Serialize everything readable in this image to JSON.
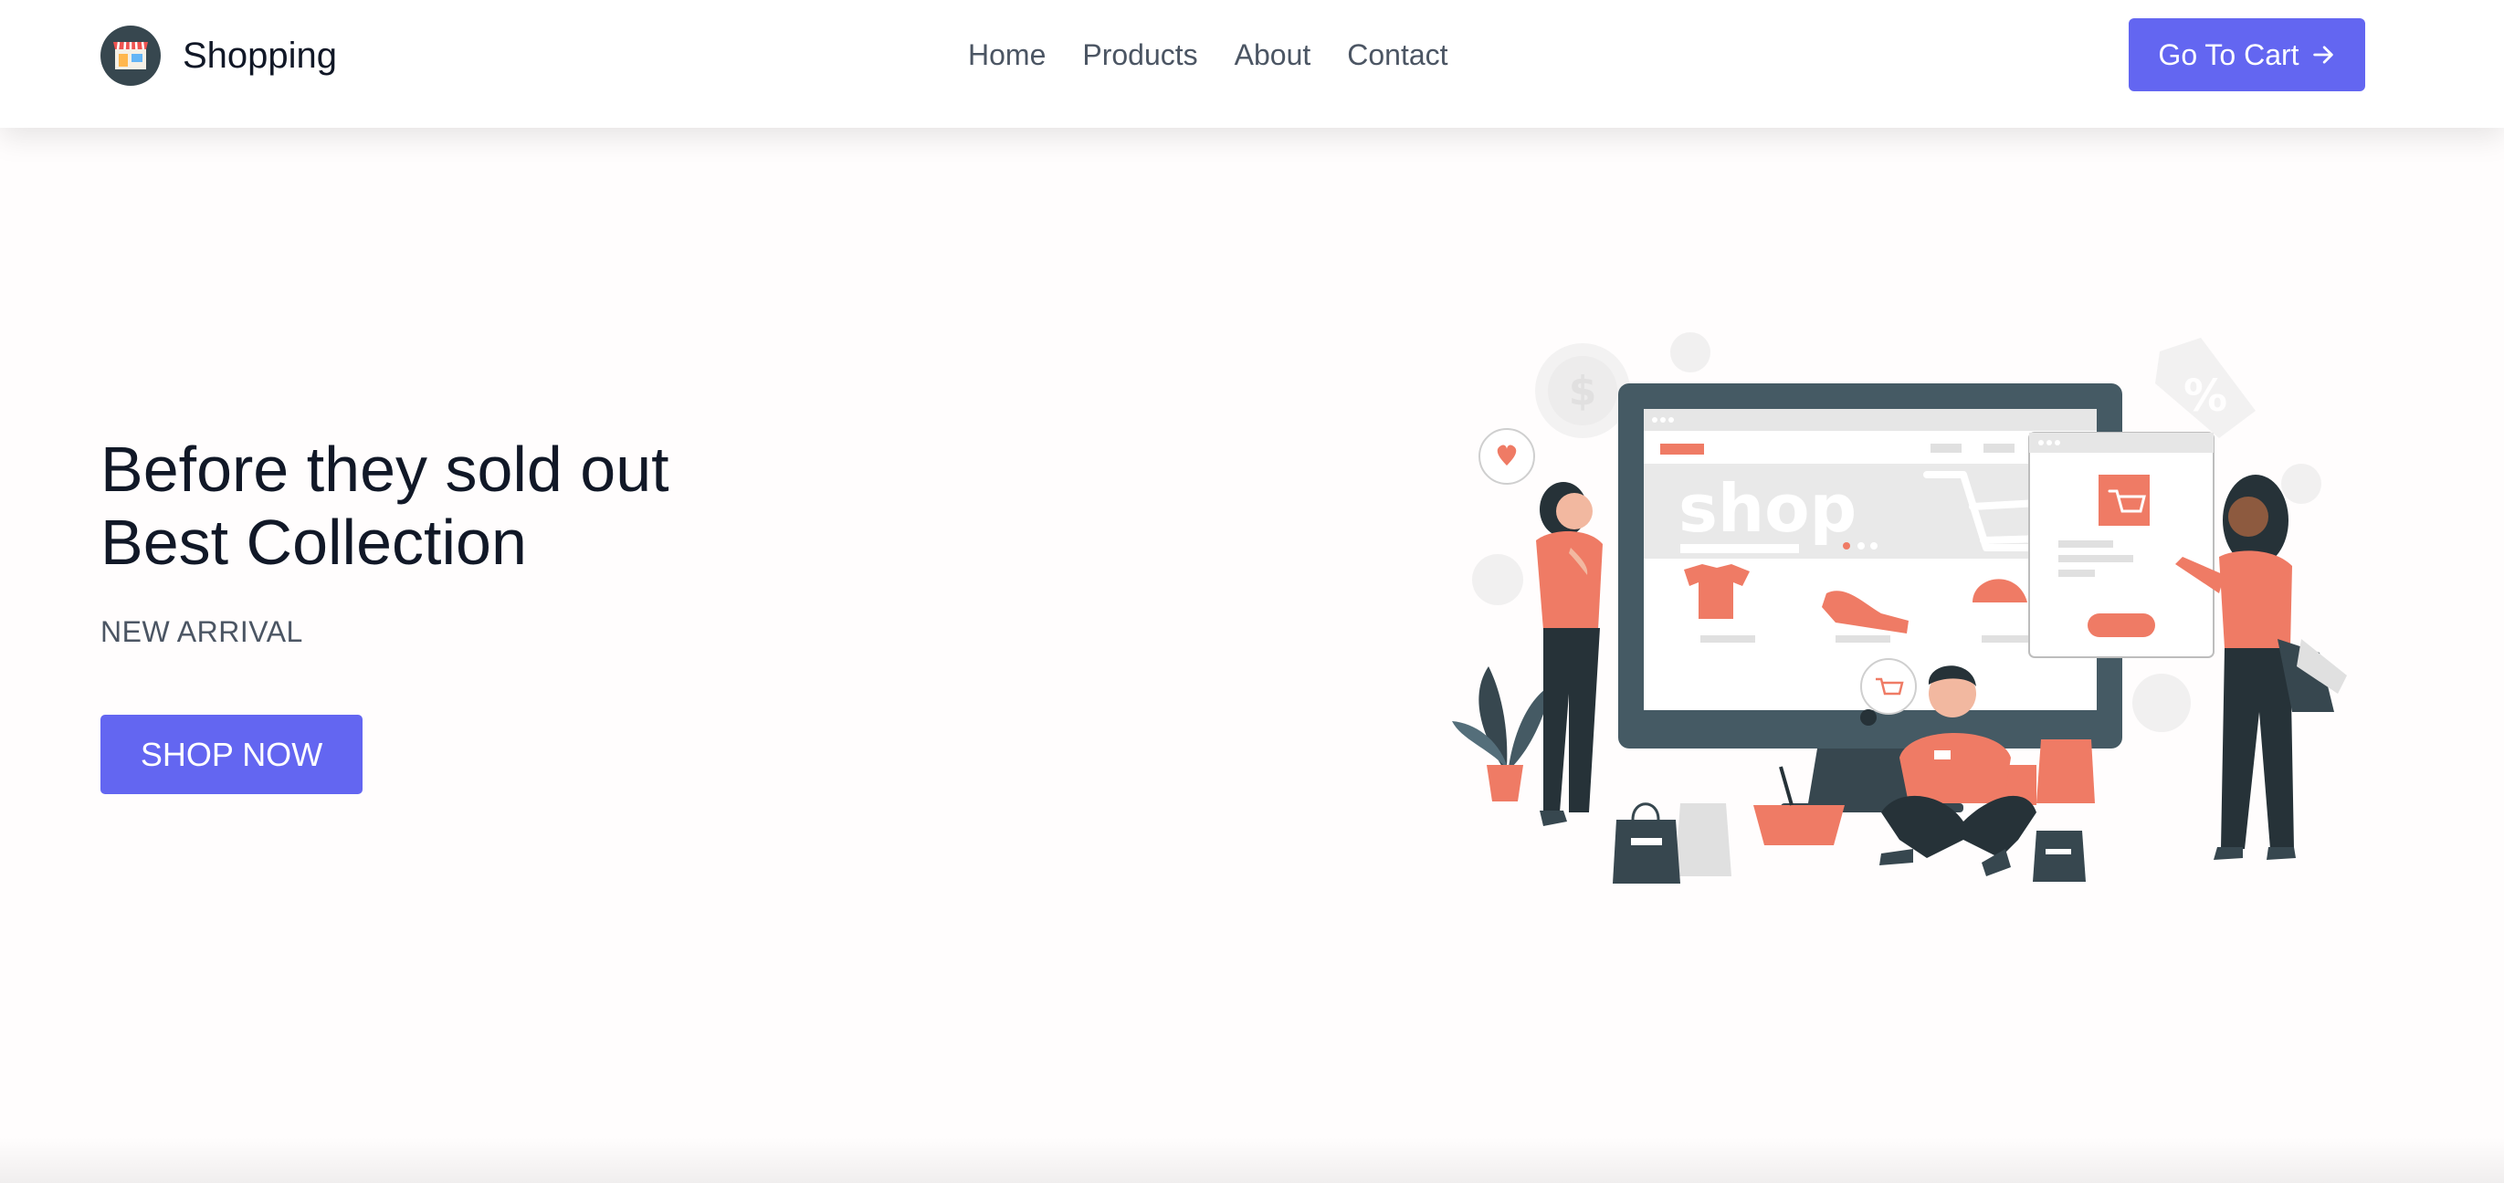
{
  "header": {
    "brand_name": "Shopping",
    "brand_icon": "storefront-icon",
    "nav": [
      "Home",
      "Products",
      "About",
      "Contact"
    ],
    "cart_button_label": "Go To Cart",
    "cart_button_icon": "arrow-right-icon"
  },
  "hero": {
    "title_line1": "Before they sold out",
    "title_line2": "Best Collection",
    "subtitle": "NEW ARRIVAL",
    "cta_label": "SHOP NOW",
    "illustration": {
      "screen_text": "shop"
    }
  },
  "colors": {
    "primary": "#6366f1",
    "accent": "#ef7b65",
    "dark": "#37474f",
    "text_dark": "#111827",
    "text_muted": "#4b5563"
  }
}
